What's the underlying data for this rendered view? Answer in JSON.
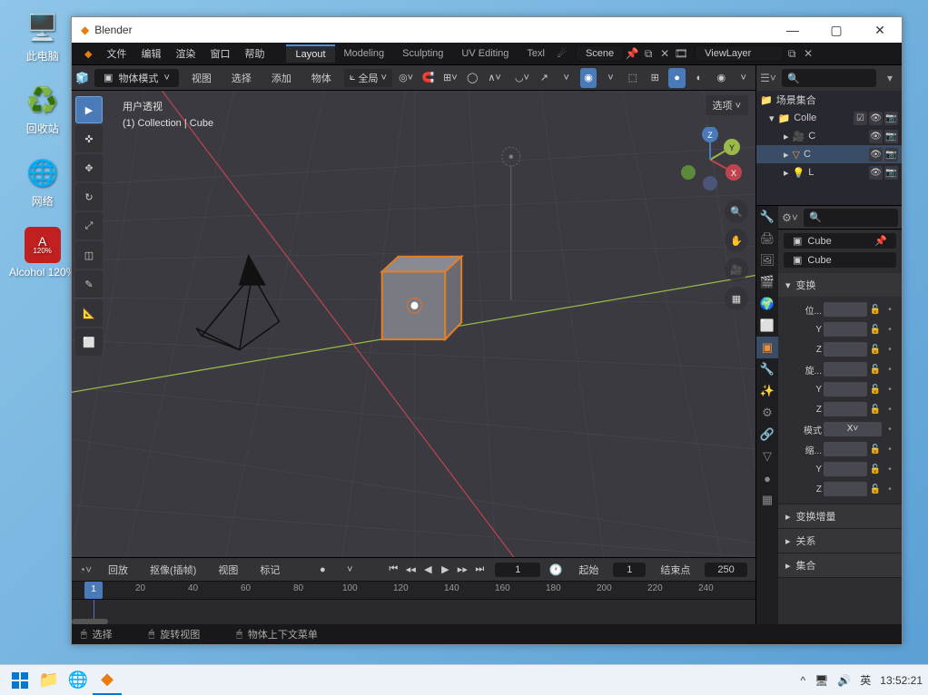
{
  "desktop": {
    "icons": [
      {
        "label": "此电脑",
        "glyph": "🖥️"
      },
      {
        "label": "回收站",
        "glyph": "♻️"
      },
      {
        "label": "网络",
        "glyph": "🖥️"
      },
      {
        "label": "Alcohol 120%",
        "glyph": "Ⓐ"
      }
    ]
  },
  "window": {
    "title": "Blender"
  },
  "topmenu": {
    "file": "文件",
    "edit": "编辑",
    "render": "渲染",
    "window": "窗口",
    "help": "帮助"
  },
  "workspaces": {
    "layout": "Layout",
    "modeling": "Modeling",
    "sculpting": "Sculpting",
    "uv": "UV Editing",
    "tex": "Texl"
  },
  "scene": {
    "name": "Scene"
  },
  "viewlayer": {
    "name": "ViewLayer"
  },
  "header3d": {
    "mode": "物体模式",
    "menu_view": "视图",
    "menu_select": "选择",
    "menu_add": "添加",
    "menu_object": "物体",
    "orientation": "全局",
    "options": "选项"
  },
  "viewport_overlay": {
    "line1": "用户透视",
    "line2": "(1) Collection | Cube"
  },
  "gizmo": {
    "x": "X",
    "y": "Y",
    "z": "Z"
  },
  "timeline": {
    "playback": "回放",
    "keying": "抠像(插帧)",
    "view": "视图",
    "marker": "标记",
    "current": "1",
    "start_lbl": "起始",
    "start": "1",
    "end_lbl": "结束点",
    "end": "250",
    "ticks": [
      "1",
      "20",
      "40",
      "60",
      "80",
      "100",
      "120",
      "140",
      "160",
      "180",
      "200",
      "220",
      "240"
    ]
  },
  "outliner": {
    "scene_collection": "场景集合",
    "coll": "Colle",
    "item_camera": "C",
    "item_cube": "C",
    "item_light": "L"
  },
  "props": {
    "crumb": "Cube",
    "nameField": "Cube",
    "transform_label": "变换",
    "loc_label": "位...",
    "rot_label": "旋...",
    "scale_label": "缩...",
    "y": "Y",
    "z": "Z",
    "mode_label": "模式",
    "mode_value": "X",
    "delta_label": "变换增量",
    "relations_label": "关系",
    "collection_label": "集合"
  },
  "statusbar": {
    "select": "选择",
    "rotate": "旋转视图",
    "context": "物体上下文菜单"
  },
  "tray": {
    "ime": "英",
    "clock": "13:52:21"
  }
}
